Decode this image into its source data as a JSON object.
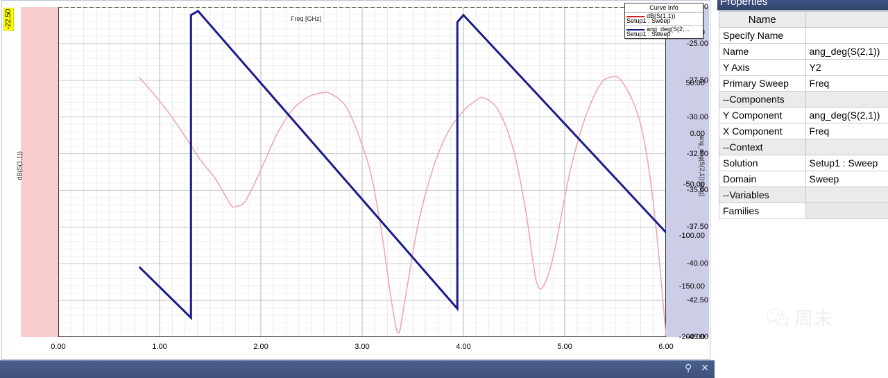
{
  "plot": {
    "x_axis": {
      "title": "Freq [GHz]",
      "ticks": [
        "0.00",
        "1.00",
        "2.00",
        "3.00",
        "4.00",
        "5.00",
        "6.00"
      ],
      "min": 0.0,
      "max": 6.0
    },
    "y1_axis": {
      "title": "dB(S(1,1))",
      "ticks": [
        "-22.50",
        "-25.00",
        "-27.50",
        "-30.00",
        "-32.50",
        "-35.00",
        "-37.50",
        "-40.00",
        "-42.50",
        "-45.00"
      ],
      "min": -45.0,
      "max": -22.5,
      "band_color": "#f9ccce"
    },
    "y2_axis": {
      "title": "ang_deg(S(2,1)) [deg]",
      "ticks": [
        "100.00",
        "50.00",
        "0.00",
        "-50.00",
        "-100.00",
        "-150.00",
        "-200.00"
      ],
      "min": -200.0,
      "max": 125.0,
      "band_color": "#cccee8"
    },
    "cursor_readout": "-22.50",
    "legend": {
      "title": "Curve Info",
      "entries": [
        {
          "expr": "dB(S(1,1))",
          "sub": "Setup1 : Sweep",
          "color": "#cc2222"
        },
        {
          "expr": "ang_deg(S(2,...",
          "sub": "Setup1 : Sweep",
          "color": "#1a1a8c"
        }
      ]
    }
  },
  "chart_data": {
    "type": "line",
    "title": "",
    "xlabel": "Freq [GHz]",
    "ylabel": "dB(S(1,1))",
    "ylabel2": "ang_deg(S(2,1)) [deg]",
    "xlim": [
      0.0,
      6.0
    ],
    "ylim": [
      -45.0,
      -22.5
    ],
    "ylim2": [
      -200.0,
      125.0
    ],
    "grid": true,
    "legend_position": "top-right",
    "series": [
      {
        "name": "dB(S(1,1))",
        "axis": "y1",
        "color": "#f0a8ac",
        "x": [
          0.8,
          0.95,
          1.1,
          1.25,
          1.4,
          1.55,
          1.7,
          1.75,
          1.85,
          2.0,
          2.15,
          2.3,
          2.45,
          2.6,
          2.7,
          2.85,
          3.0,
          3.1,
          3.2,
          3.3,
          3.36,
          3.42,
          3.55,
          3.7,
          3.85,
          4.0,
          4.1,
          4.2,
          4.35,
          4.5,
          4.62,
          4.72,
          4.8,
          4.9,
          5.05,
          5.2,
          5.35,
          5.45,
          5.55,
          5.7,
          5.8,
          5.9,
          6.0
        ],
        "y": [
          -27.3,
          -28.5,
          -29.8,
          -31.3,
          -32.9,
          -34.2,
          -35.95,
          -36.1,
          -35.7,
          -33.6,
          -31.3,
          -29.6,
          -28.7,
          -28.35,
          -28.45,
          -29.4,
          -31.9,
          -34.3,
          -38.2,
          -43.0,
          -44.7,
          -42.6,
          -37.4,
          -33.5,
          -31.0,
          -29.6,
          -29.0,
          -28.7,
          -29.6,
          -32.4,
          -36.6,
          -41.2,
          -41.4,
          -39.1,
          -33.8,
          -30.1,
          -27.8,
          -27.3,
          -27.45,
          -29.4,
          -32.2,
          -37.4,
          -44.9
        ]
      },
      {
        "name": "ang_deg(S(2,1))",
        "axis": "y2",
        "color": "#1a1a8c",
        "comment": "Sawtooth phase: descending ramps with 360-deg wraps near 1.31 GHz and 3.94 GHz",
        "x": [
          0.8,
          1.31,
          1.31,
          1.38,
          3.94,
          3.94,
          4.0,
          6.0
        ],
        "y": [
          -131.0,
          -181.0,
          117.0,
          121.0,
          -172.0,
          110.0,
          117.0,
          -97.0
        ]
      }
    ]
  },
  "properties": {
    "title": "Properties",
    "column_header": "Name",
    "rows": [
      {
        "name": "Specify Name",
        "value": "",
        "section": false
      },
      {
        "name": "Name",
        "value": "ang_deg(S(2,1))",
        "section": false
      },
      {
        "name": "Y Axis",
        "value": "Y2",
        "section": false
      },
      {
        "name": "Primary Sweep",
        "value": "Freq",
        "section": false
      },
      {
        "name": "--Components",
        "value": "",
        "section": true
      },
      {
        "name": "Y Component",
        "value": "ang_deg(S(2,1))",
        "section": false
      },
      {
        "name": "X Component",
        "value": "Freq",
        "section": false
      },
      {
        "name": "--Context",
        "value": "",
        "section": true
      },
      {
        "name": "Solution",
        "value": "Setup1 : Sweep",
        "section": false
      },
      {
        "name": "Domain",
        "value": "Sweep",
        "section": false
      },
      {
        "name": "--Variables",
        "value": "",
        "section": true
      },
      {
        "name": "Families",
        "value": "",
        "section": false
      }
    ]
  },
  "bottom_bar": {
    "pin_icon": "pin-icon",
    "close_icon": "close-icon",
    "pin_glyph": "⚲",
    "close_glyph": "✕"
  },
  "watermark": {
    "text": "周末"
  }
}
